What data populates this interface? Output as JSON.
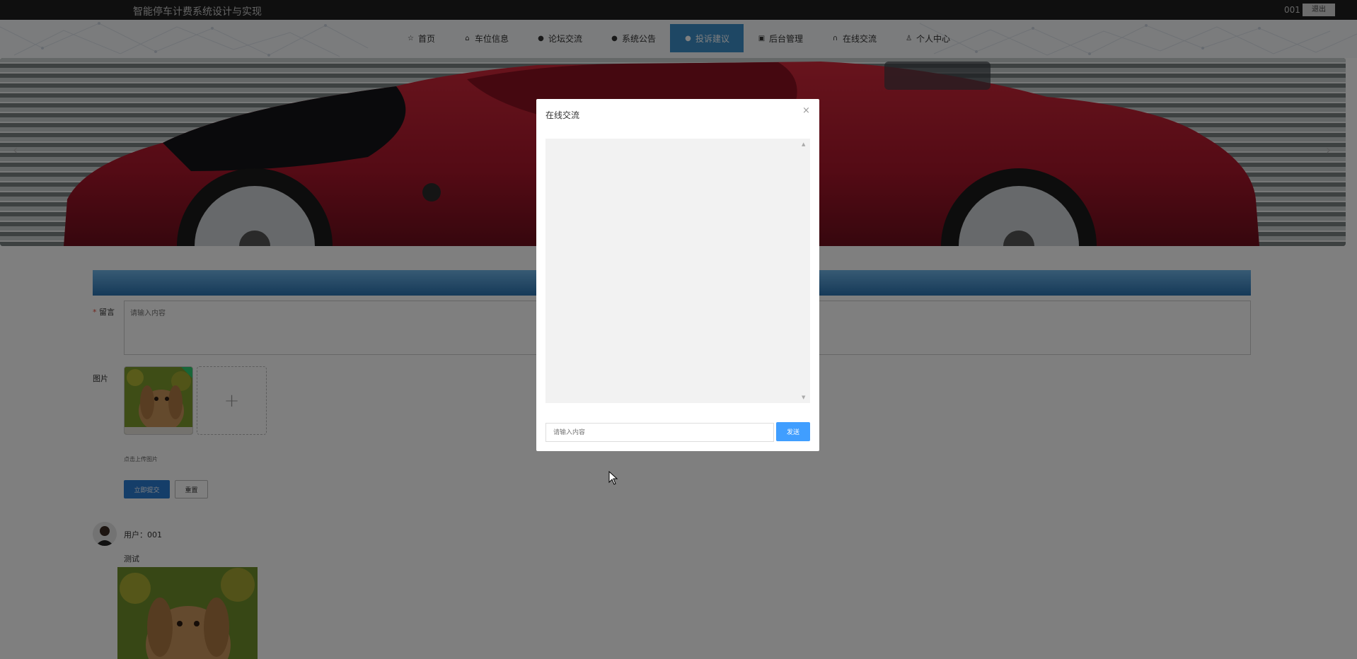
{
  "header": {
    "site_title": "智能停车计费系统设计与实现",
    "username": "001",
    "logout_label": "退出"
  },
  "nav": {
    "items": [
      {
        "label": "首页",
        "icon": "star-icon"
      },
      {
        "label": "车位信息",
        "icon": "lock-icon"
      },
      {
        "label": "论坛交流",
        "icon": "info-icon"
      },
      {
        "label": "系统公告",
        "icon": "question-icon"
      },
      {
        "label": "投诉建议",
        "icon": "info-icon",
        "active": true
      },
      {
        "label": "后台管理",
        "icon": "calendar-icon"
      },
      {
        "label": "在线交流",
        "icon": "headset-icon"
      },
      {
        "label": "个人中心",
        "icon": "user-icon"
      }
    ]
  },
  "banner": {
    "prev_arrow": "‹",
    "next_arrow": "›"
  },
  "form": {
    "message_label": "留言",
    "required_mark": "*",
    "message_placeholder": "请输入内容",
    "image_label": "图片",
    "upload_hint": "点击上传图片",
    "upload_plus": "+",
    "submit_label": "立即提交",
    "reset_label": "重置"
  },
  "comment": {
    "user_line": "用户：001",
    "text": "测试"
  },
  "dialog": {
    "title": "在线交流",
    "close_glyph": "×",
    "input_placeholder": "请输入内容",
    "send_label": "发送",
    "scroll_up": "▲",
    "scroll_down": "▼"
  },
  "colors": {
    "nav_active": "#3d8ec8",
    "submit_primary": "#2b7cd3",
    "send_button": "#409eff",
    "top_bar": "#1f1f1f"
  }
}
